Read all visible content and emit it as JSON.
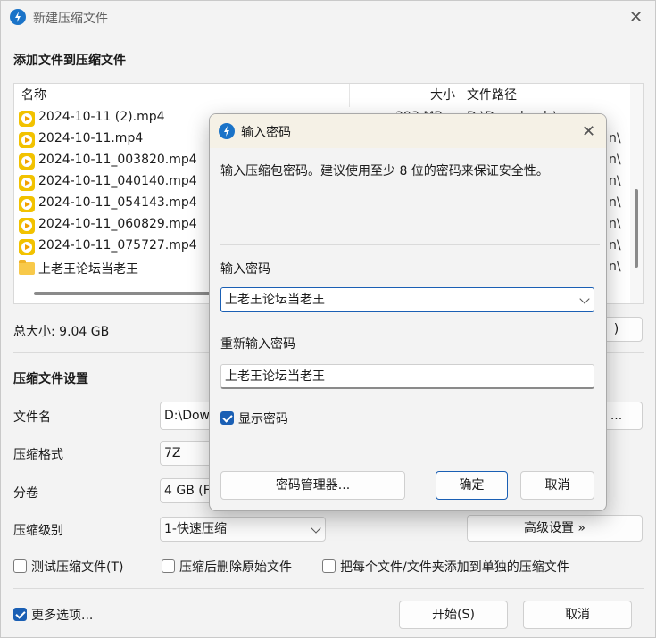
{
  "window": {
    "title": "新建压缩文件",
    "add_files_heading": "添加文件到压缩文件"
  },
  "file_list": {
    "columns": {
      "name": "名称",
      "size": "大小",
      "path": "文件路径"
    },
    "rows": [
      {
        "name": "2024-10-11 (2).mp4",
        "size": "293 MB",
        "path": "D:\\Downloads\\v",
        "icon": "mp4-icon"
      },
      {
        "name": "2024-10-11.mp4",
        "size": "",
        "path": "n\\",
        "icon": "mp4-icon"
      },
      {
        "name": "2024-10-11_003820.mp4",
        "size": "",
        "path": "n\\",
        "icon": "mp4-icon"
      },
      {
        "name": "2024-10-11_040140.mp4",
        "size": "",
        "path": "n\\",
        "icon": "mp4-icon"
      },
      {
        "name": "2024-10-11_054143.mp4",
        "size": "",
        "path": "n\\",
        "icon": "mp4-icon"
      },
      {
        "name": "2024-10-11_060829.mp4",
        "size": "",
        "path": "n\\",
        "icon": "mp4-icon"
      },
      {
        "name": "2024-10-11_075727.mp4",
        "size": "",
        "path": "n\\",
        "icon": "mp4-icon"
      },
      {
        "name": "上老王论坛当老王",
        "size": "",
        "path": "n\\",
        "icon": "folder-icon"
      }
    ]
  },
  "total_size": "总大小: 9.04 GB",
  "settings": {
    "heading": "压缩文件设置",
    "filename_label": "文件名",
    "filename_value": "D:\\Dow",
    "browse_label": "...",
    "format_label": "压缩格式",
    "format_value": "7Z",
    "split_label": "分卷",
    "split_value": "4 GB (F",
    "level_label": "压缩级别",
    "level_value": "1-快速压缩",
    "advanced_label": "高级设置 »",
    "test_archive": "测试压缩文件(T)",
    "delete_after": "压缩后删除原始文件",
    "separate_archives": "把每个文件/文件夹添加到单独的压缩文件",
    "more_options": "更多选项...",
    "start_label": "开始(S)",
    "cancel_label": "取消"
  },
  "dialog": {
    "title": "输入密码",
    "description": "输入压缩包密码。建议使用至少 8 位的密码来保证安全性。",
    "password_label": "输入密码",
    "password_value": "上老王论坛当老王",
    "confirm_label": "重新输入密码",
    "confirm_value": "上老王论坛当老王",
    "show_password": "显示密码",
    "manager_label": "密码管理器...",
    "ok_label": "确定",
    "cancel_label": "取消"
  },
  "colors": {
    "accent": "#1a5fb4",
    "app_icon": "#1a73c8",
    "mp4_icon": "#f2c200",
    "folder": "#f8c94a"
  }
}
